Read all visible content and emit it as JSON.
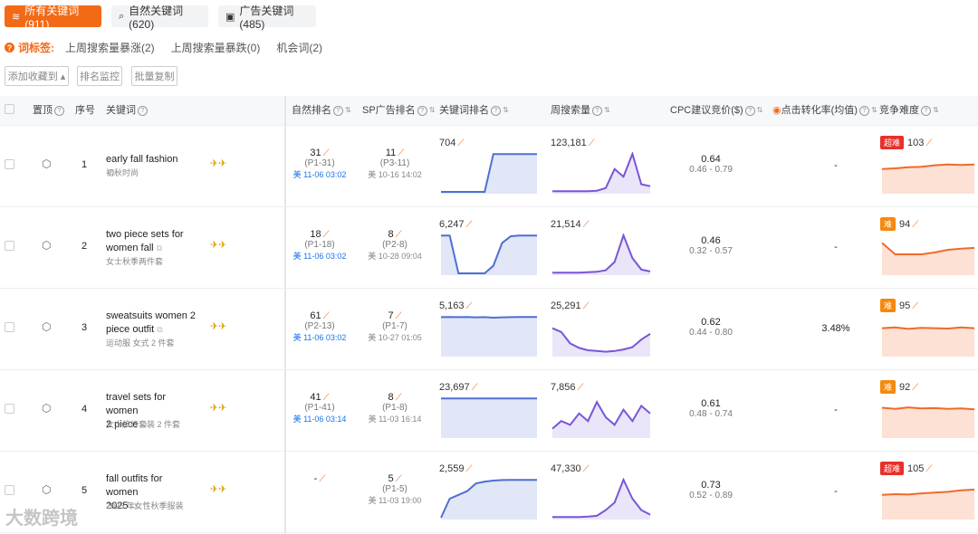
{
  "tabs": [
    {
      "label": "所有关键词 (911)",
      "icon": "layers-icon"
    },
    {
      "label": "自然关键词 (620)",
      "icon": "search-icon"
    },
    {
      "label": "广告关键词 (485)",
      "icon": "ad-icon"
    }
  ],
  "tag_filter": {
    "label": "词标签:",
    "options": [
      "上周搜索量暴涨(2)",
      "上周搜索量暴跌(0)",
      "机会词(2)"
    ]
  },
  "actions": {
    "favorite": "添加收藏到 ▴",
    "monitor": "排名监控",
    "copy": "批量复制"
  },
  "headers": {
    "pin": "置顶",
    "index": "序号",
    "keyword": "关键词",
    "organic": "自然排名",
    "sp": "SP广告排名",
    "kw_rank": "关键词排名",
    "weekly": "周搜索量",
    "cpc": "CPC建议竞价($)",
    "cvr": "点击转化率(均值)",
    "comp": "竞争难度"
  },
  "rows": [
    {
      "index": "1",
      "kw1": "early fall fashion",
      "kw2": "",
      "kwsub": "初秋时尚",
      "organic": "31",
      "organic_p": "(P1-31)",
      "organic_date": "美 11-06 03:02",
      "sp": "11",
      "sp_p": "(P3-11)",
      "sp_date": "美 10-16 14:02",
      "kw_rank": "704",
      "weekly": "123,181",
      "cpc": "0.64",
      "cpc_range": "0.46 - 0.79",
      "cvr": "-",
      "comp_badge": "超难",
      "comp": "103",
      "rank_series": [
        [
          0,
          200
        ],
        [
          1,
          200
        ],
        [
          2,
          200
        ],
        [
          3,
          200
        ],
        [
          4,
          200
        ],
        [
          5,
          200
        ],
        [
          6,
          1
        ],
        [
          7,
          1
        ],
        [
          8,
          1
        ],
        [
          9,
          1
        ],
        [
          10,
          1
        ],
        [
          11,
          1
        ]
      ],
      "weekly_series": [
        [
          0,
          2
        ],
        [
          1,
          2
        ],
        [
          2,
          2
        ],
        [
          3,
          2
        ],
        [
          4,
          2
        ],
        [
          5,
          3
        ],
        [
          6,
          10
        ],
        [
          7,
          60
        ],
        [
          8,
          40
        ],
        [
          9,
          100
        ],
        [
          10,
          20
        ],
        [
          11,
          15
        ]
      ],
      "comp_series": [
        [
          0,
          0.6
        ],
        [
          1,
          0.62
        ],
        [
          2,
          0.65
        ],
        [
          3,
          0.66
        ],
        [
          4,
          0.7
        ],
        [
          5,
          0.72
        ],
        [
          6,
          0.71
        ],
        [
          7,
          0.72
        ]
      ]
    },
    {
      "index": "2",
      "kw1": "two piece sets for",
      "kw2": "women fall",
      "kwsub": "女士秋季两件套",
      "organic": "18",
      "organic_p": "(P1-18)",
      "organic_date": "美 11-06 03:02",
      "sp": "8",
      "sp_p": "(P2-8)",
      "sp_date": "美 10-28 09:04",
      "kw_rank": "6,247",
      "weekly": "21,514",
      "cpc": "0.46",
      "cpc_range": "0.32 - 0.57",
      "cvr": "-",
      "comp_badge": "难",
      "comp": "94",
      "rank_series": [
        [
          0,
          1
        ],
        [
          1,
          1
        ],
        [
          2,
          200
        ],
        [
          3,
          200
        ],
        [
          4,
          200
        ],
        [
          5,
          200
        ],
        [
          6,
          160
        ],
        [
          7,
          40
        ],
        [
          8,
          5
        ],
        [
          9,
          1
        ],
        [
          10,
          1
        ],
        [
          11,
          1
        ]
      ],
      "weekly_series": [
        [
          0,
          2
        ],
        [
          1,
          2
        ],
        [
          2,
          2
        ],
        [
          3,
          2
        ],
        [
          4,
          3
        ],
        [
          5,
          4
        ],
        [
          6,
          8
        ],
        [
          7,
          30
        ],
        [
          8,
          100
        ],
        [
          9,
          40
        ],
        [
          10,
          10
        ],
        [
          11,
          5
        ]
      ],
      "comp_series": [
        [
          0,
          0.8
        ],
        [
          1,
          0.5
        ],
        [
          2,
          0.5
        ],
        [
          3,
          0.5
        ],
        [
          4,
          0.55
        ],
        [
          5,
          0.62
        ],
        [
          6,
          0.65
        ],
        [
          7,
          0.67
        ]
      ]
    },
    {
      "index": "3",
      "kw1": "sweatsuits women 2",
      "kw2": "piece outfit",
      "kwsub": "运动服 女式 2 件套",
      "organic": "61",
      "organic_p": "(P2-13)",
      "organic_date": "美 11-06 03:02",
      "sp": "7",
      "sp_p": "(P1-7)",
      "sp_date": "美 10-27 01:05",
      "kw_rank": "5,163",
      "weekly": "25,291",
      "cpc": "0.62",
      "cpc_range": "0.44 - 0.80",
      "cvr": "3.48%",
      "comp_badge": "难",
      "comp": "95",
      "rank_series": [
        [
          0,
          2
        ],
        [
          1,
          1
        ],
        [
          2,
          2
        ],
        [
          3,
          1
        ],
        [
          4,
          3
        ],
        [
          5,
          2
        ],
        [
          6,
          5
        ],
        [
          7,
          3
        ],
        [
          8,
          2
        ],
        [
          9,
          1
        ],
        [
          10,
          1
        ],
        [
          11,
          1
        ]
      ],
      "weekly_series": [
        [
          0,
          70
        ],
        [
          1,
          60
        ],
        [
          2,
          30
        ],
        [
          3,
          18
        ],
        [
          4,
          12
        ],
        [
          5,
          10
        ],
        [
          6,
          8
        ],
        [
          7,
          10
        ],
        [
          8,
          14
        ],
        [
          9,
          20
        ],
        [
          10,
          40
        ],
        [
          11,
          55
        ]
      ],
      "comp_series": [
        [
          0,
          0.7
        ],
        [
          1,
          0.72
        ],
        [
          2,
          0.68
        ],
        [
          3,
          0.71
        ],
        [
          4,
          0.7
        ],
        [
          5,
          0.69
        ],
        [
          6,
          0.72
        ],
        [
          7,
          0.7
        ]
      ]
    },
    {
      "index": "4",
      "kw1": "travel sets for women",
      "kw2": "2 piece",
      "kwsub": "女士旅行套装 2 件套",
      "organic": "41",
      "organic_p": "(P1-41)",
      "organic_date": "美 11-06 03:14",
      "sp": "8",
      "sp_p": "(P1-8)",
      "sp_date": "美 11-03 16:14",
      "kw_rank": "23,697",
      "weekly": "7,856",
      "cpc": "0.61",
      "cpc_range": "0.48 - 0.74",
      "cvr": "-",
      "comp_badge": "难",
      "comp": "92",
      "rank_series": [
        [
          0,
          1
        ],
        [
          1,
          1
        ],
        [
          2,
          1
        ],
        [
          3,
          1
        ],
        [
          4,
          1
        ],
        [
          5,
          1
        ],
        [
          6,
          1
        ],
        [
          7,
          1
        ],
        [
          8,
          1
        ],
        [
          9,
          1
        ],
        [
          10,
          1
        ],
        [
          11,
          1
        ]
      ],
      "weekly_series": [
        [
          0,
          20
        ],
        [
          1,
          40
        ],
        [
          2,
          30
        ],
        [
          3,
          60
        ],
        [
          4,
          40
        ],
        [
          5,
          90
        ],
        [
          6,
          50
        ],
        [
          7,
          30
        ],
        [
          8,
          70
        ],
        [
          9,
          40
        ],
        [
          10,
          80
        ],
        [
          11,
          60
        ]
      ],
      "comp_series": [
        [
          0,
          0.75
        ],
        [
          1,
          0.72
        ],
        [
          2,
          0.76
        ],
        [
          3,
          0.73
        ],
        [
          4,
          0.74
        ],
        [
          5,
          0.72
        ],
        [
          6,
          0.73
        ],
        [
          7,
          0.71
        ]
      ]
    },
    {
      "index": "5",
      "kw1": "fall outfits for women",
      "kw2": "2025",
      "kwsub": "2025 年女性秋季服装",
      "organic": "-",
      "organic_p": "",
      "organic_date": "",
      "sp": "5",
      "sp_p": "(P1-5)",
      "sp_date": "美 11-03 19:00",
      "kw_rank": "2,559",
      "weekly": "47,330",
      "cpc": "0.73",
      "cpc_range": "0.52 - 0.89",
      "cvr": "-",
      "comp_badge": "超难",
      "comp": "105",
      "rank_series": [
        [
          0,
          200
        ],
        [
          1,
          100
        ],
        [
          2,
          80
        ],
        [
          3,
          60
        ],
        [
          4,
          20
        ],
        [
          5,
          10
        ],
        [
          6,
          5
        ],
        [
          7,
          2
        ],
        [
          8,
          1
        ],
        [
          9,
          1
        ],
        [
          10,
          1
        ],
        [
          11,
          1
        ]
      ],
      "weekly_series": [
        [
          0,
          2
        ],
        [
          1,
          2
        ],
        [
          2,
          2
        ],
        [
          3,
          2
        ],
        [
          4,
          3
        ],
        [
          5,
          5
        ],
        [
          6,
          20
        ],
        [
          7,
          40
        ],
        [
          8,
          100
        ],
        [
          9,
          50
        ],
        [
          10,
          20
        ],
        [
          11,
          8
        ]
      ],
      "comp_series": [
        [
          0,
          0.6
        ],
        [
          1,
          0.62
        ],
        [
          2,
          0.61
        ],
        [
          3,
          0.64
        ],
        [
          4,
          0.66
        ],
        [
          5,
          0.68
        ],
        [
          6,
          0.72
        ],
        [
          7,
          0.74
        ]
      ]
    }
  ],
  "watermark": "大数跨境"
}
